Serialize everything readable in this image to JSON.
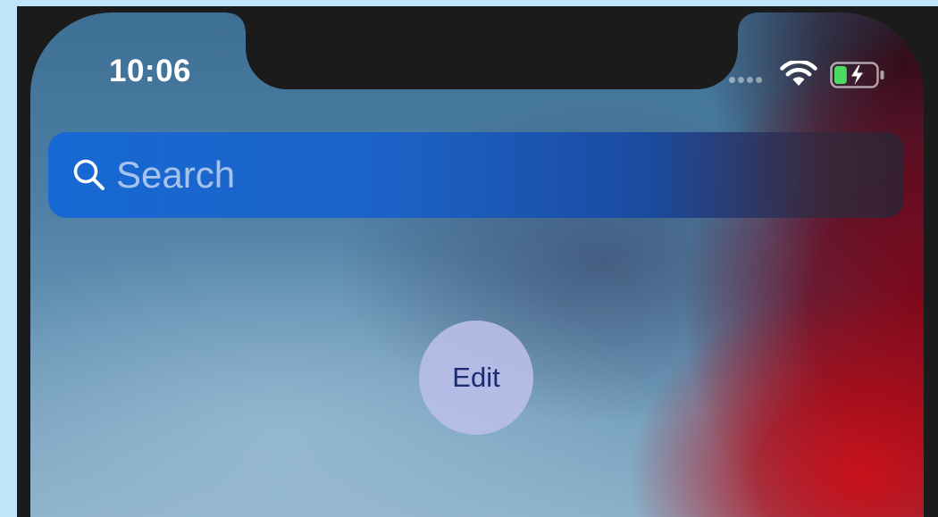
{
  "status_bar": {
    "time": "10:06",
    "signal_icon": "cellular-signal-dots-icon",
    "wifi_icon": "wifi-icon",
    "battery_icon": "battery-charging-icon",
    "battery_level": 0.3,
    "battery_fill_color": "#4cd964"
  },
  "search": {
    "placeholder": "Search",
    "value": "",
    "icon": "search-icon"
  },
  "edit_button": {
    "label": "Edit"
  },
  "colors": {
    "page_background": "#bfe5fb",
    "search_bar_blue": "#1769d4",
    "edit_button_text": "#1a2c74",
    "wallpaper_blue": "#4d7ea3",
    "wallpaper_red": "#cd0e18"
  }
}
